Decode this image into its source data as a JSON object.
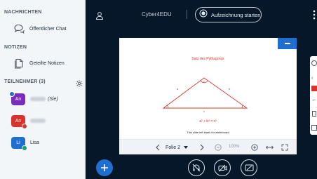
{
  "sidebar": {
    "messages_title": "NACHRICHTEN",
    "public_chat_label": "Öffentlicher Chat",
    "notes_title": "NOTIZEN",
    "shared_notes_label": "Geteilte Notizen",
    "participants_title": "TEILNEHMER (3)",
    "participants": [
      {
        "initials": "An",
        "name": "",
        "suffix": "(Sie)",
        "color": "#7a2dbb",
        "badge_color": "#1f6fd1"
      },
      {
        "initials": "An",
        "name": "",
        "suffix": "",
        "color": "#d9342b",
        "badge_color": "#d9342b"
      },
      {
        "initials": "Li",
        "name": "Lisa",
        "suffix": "",
        "color": "#1f6fd1",
        "badge_color": "#139e6f"
      }
    ]
  },
  "header": {
    "title": "Cyber4EDU",
    "record_label": "Aufzeichnung starten"
  },
  "slide": {
    "title": "Satz des Pythagoras",
    "label_a": "a",
    "label_b": "b",
    "label_c": "c",
    "formula": "a² + b² = c²",
    "note": "This slide left blank for whiteboard"
  },
  "slide_toolbar": {
    "page_label": "Folie 2",
    "zoom": "100%"
  },
  "colors": {
    "accent": "#1f6fd1",
    "background": "#06172a",
    "slide_red": "#d9342b"
  }
}
